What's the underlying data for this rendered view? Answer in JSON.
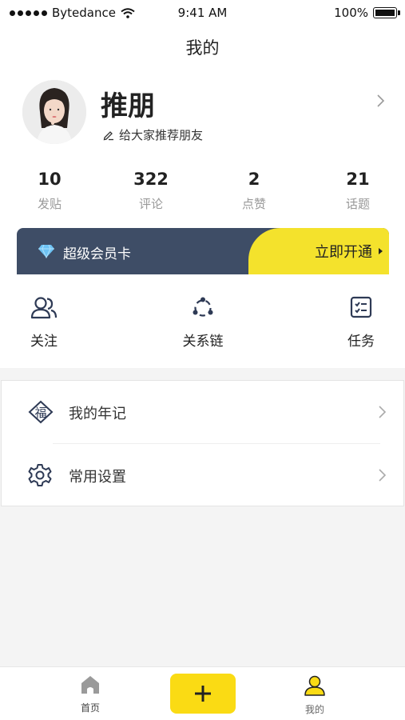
{
  "status_bar": {
    "carrier": "Bytedance",
    "time": "9:41 AM",
    "battery": "100%"
  },
  "header": {
    "title": "我的"
  },
  "profile": {
    "name": "推朋",
    "signature": "给大家推荐朋友"
  },
  "stats": [
    {
      "value": "10",
      "label": "发贴"
    },
    {
      "value": "322",
      "label": "评论"
    },
    {
      "value": "2",
      "label": "点赞"
    },
    {
      "value": "21",
      "label": "话题"
    }
  ],
  "vip": {
    "title": "超级会员卡",
    "action": "立即开通"
  },
  "quick_actions": [
    {
      "label": "关注",
      "icon": "user-follow-icon"
    },
    {
      "label": "关系链",
      "icon": "network-icon"
    },
    {
      "label": "任务",
      "icon": "task-checklist-icon"
    }
  ],
  "menu": [
    {
      "label": "我的年记",
      "icon": "fu-badge-icon",
      "icon_text": "福"
    },
    {
      "label": "常用设置",
      "icon": "gear-icon"
    }
  ],
  "tabbar": {
    "items": [
      {
        "label": "首页",
        "icon": "home-icon"
      },
      {
        "label": "",
        "icon": "plus-icon"
      },
      {
        "label": "我的",
        "icon": "user-icon"
      }
    ]
  },
  "colors": {
    "accent": "#FADB14",
    "vip_bg": "#3E4D66",
    "text": "#222222",
    "muted": "#999999"
  }
}
